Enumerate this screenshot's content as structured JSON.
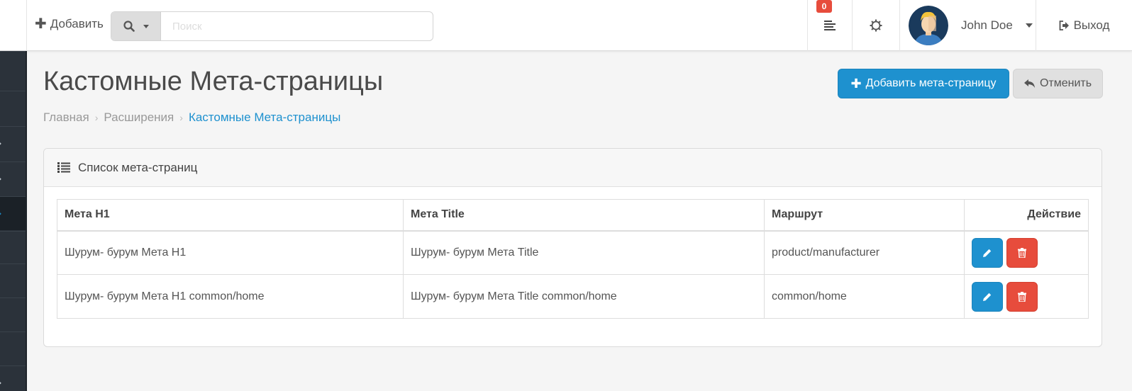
{
  "header": {
    "add_label": "Добавить",
    "search_placeholder": "Поиск",
    "notifications_count": "0",
    "user_name": "John Doe",
    "logout_label": "Выход"
  },
  "page": {
    "title": "Кастомные Мета-страницы",
    "add_button": "Добавить мета-страницу",
    "cancel_button": "Отменить",
    "breadcrumb": [
      "Главная",
      "Расширения",
      "Кастомные Мета-страницы"
    ]
  },
  "panel": {
    "title": "Список мета-страниц",
    "columns": [
      "Мета H1",
      "Мета Title",
      "Маршрут",
      "Действие"
    ],
    "rows": [
      [
        "Шурум- бурум Мета H1",
        "Шурум- бурум Мета Title",
        "product/manufacturer"
      ],
      [
        "Шурум- бурум Мета H1 common/home",
        "Шурум- бурум Мета Title common/home",
        "common/home"
      ]
    ]
  },
  "colors": {
    "primary": "#1e91cf",
    "danger": "#e74c3c",
    "sidebar": "#2b323a"
  },
  "icons": [
    "plus-icon",
    "search-icon",
    "caret-down-icon",
    "list-icon",
    "gear-icon",
    "logout-icon",
    "undo-icon",
    "pencil-icon",
    "trash-icon",
    "chevron-right-icon"
  ]
}
